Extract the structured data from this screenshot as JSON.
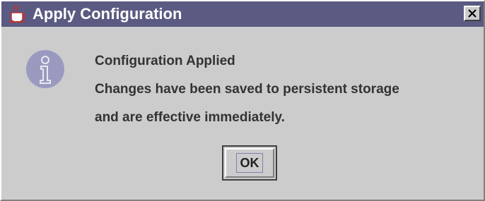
{
  "window": {
    "title": "Apply Configuration",
    "close_icon": "close-icon",
    "app_icon": "java-cup-icon"
  },
  "dialog": {
    "icon": "information-icon",
    "heading": "Configuration Applied",
    "line1": "Changes have been saved to persistent storage",
    "line2": "and are effective immediately.",
    "ok_label": "OK"
  },
  "colors": {
    "titlebar": "#5a5a82",
    "background": "#cccccc",
    "info_icon": "#9a9ac0"
  }
}
